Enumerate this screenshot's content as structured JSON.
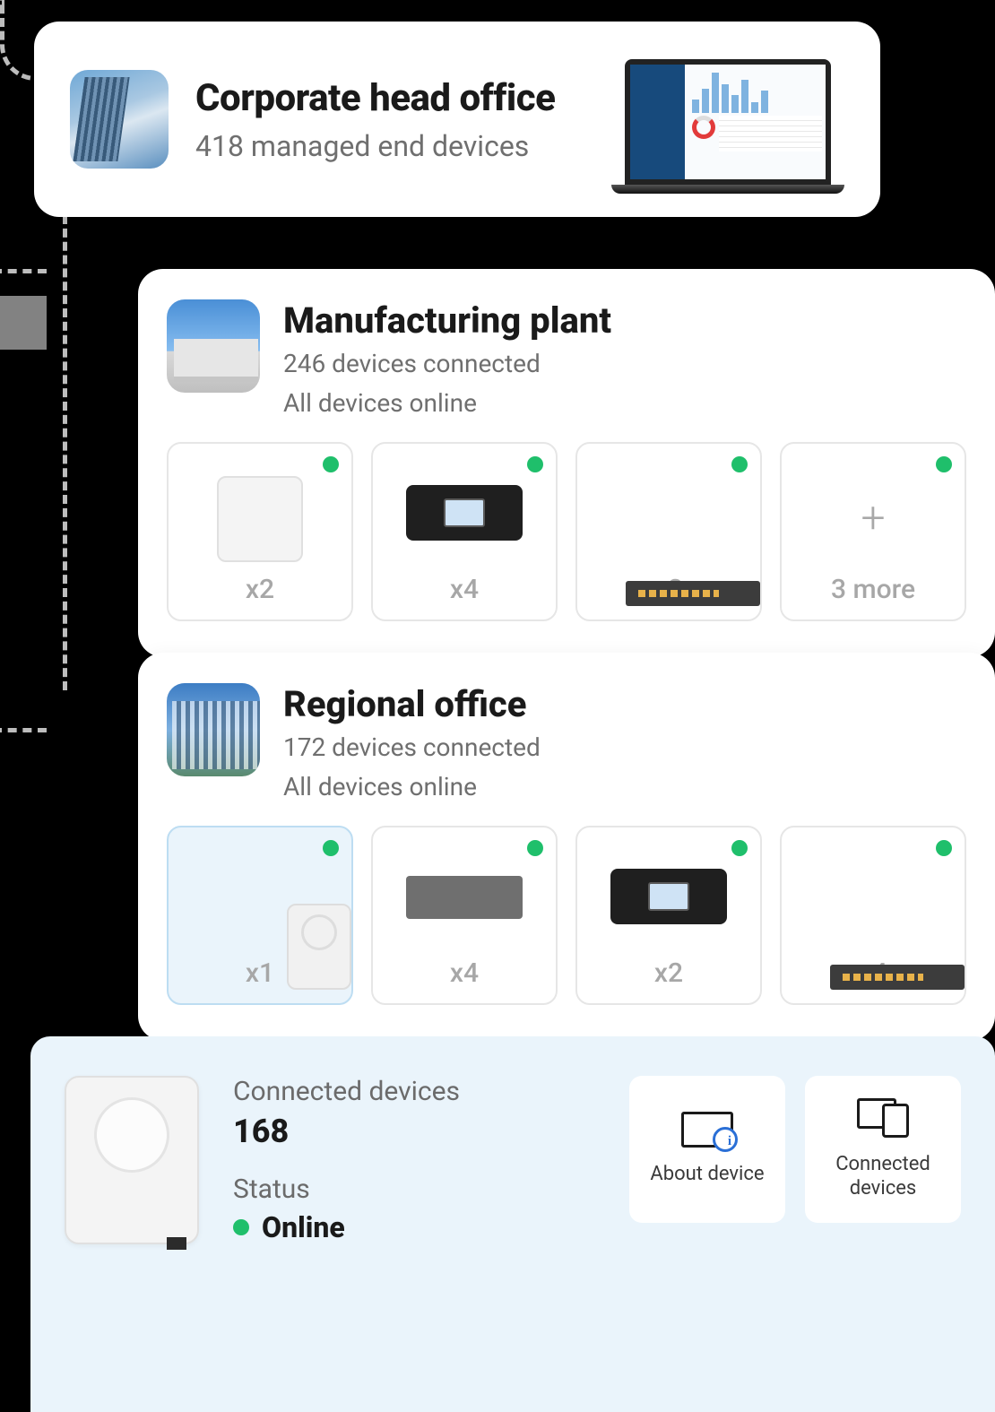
{
  "head_office": {
    "title": "Corporate head office",
    "subtitle": "418 managed end devices"
  },
  "sites": {
    "manufacturing": {
      "title": "Manufacturing plant",
      "line1": "246 devices connected",
      "line2": "All devices online",
      "devices": [
        {
          "count": "x2",
          "type": "access-point"
        },
        {
          "count": "x4",
          "type": "router"
        },
        {
          "count": "x3",
          "type": "switch"
        },
        {
          "count": "3 more",
          "type": "more"
        }
      ]
    },
    "regional": {
      "title": "Regional office",
      "line1": "172 devices connected",
      "line2": "All devices online",
      "devices": [
        {
          "count": "x1",
          "type": "gateway",
          "selected": true
        },
        {
          "count": "x4",
          "type": "box"
        },
        {
          "count": "x2",
          "type": "router"
        },
        {
          "count": "x4",
          "type": "switch"
        }
      ]
    }
  },
  "detail": {
    "connected_label": "Connected devices",
    "connected_value": "168",
    "status_label": "Status",
    "status_value": "Online",
    "actions": {
      "about": "About device",
      "connected": "Connected devices"
    }
  },
  "colors": {
    "online": "#1fbf6b",
    "selected_bg": "#eaf4fb"
  }
}
